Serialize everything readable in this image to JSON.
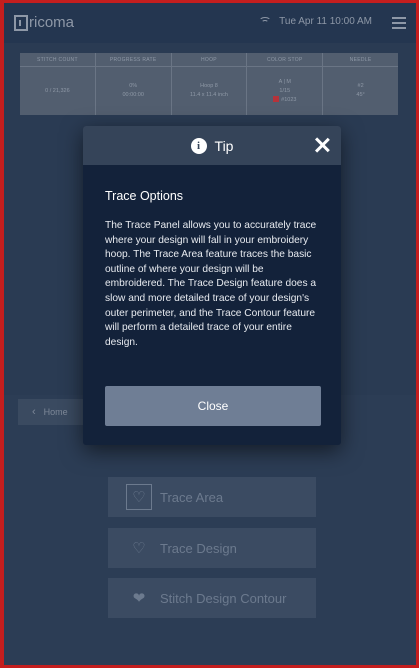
{
  "header": {
    "logo_text": "ricoma",
    "datetime": "Tue Apr 11 10:00 AM"
  },
  "info_strip": {
    "columns": [
      {
        "header": "STITCH COUNT",
        "lines": [
          "0 / 21,326"
        ]
      },
      {
        "header": "PROGRESS RATE",
        "lines": [
          "0%",
          "00:00:00"
        ]
      },
      {
        "header": "HOOP",
        "lines": [
          "Hoop 8",
          "11.4 x 11.4 inch"
        ]
      },
      {
        "header": "COLOR STOP",
        "lines": [
          "A | M",
          "1/15",
          "#1023"
        ]
      },
      {
        "header": "NEEDLE",
        "lines": [
          "#2",
          "45°"
        ]
      }
    ]
  },
  "nav": {
    "home_label": "Home"
  },
  "tools": [
    {
      "label": "Trace Area",
      "icon": "heart-outline-icon"
    },
    {
      "label": "Trace Design",
      "icon": "heart-icon"
    },
    {
      "label": "Stitch Design Contour",
      "icon": "stitched-heart-icon"
    }
  ],
  "modal": {
    "header_title": "Tip",
    "title": "Trace Options",
    "body": "The Trace Panel allows you to accurately trace where your design will fall in your embroidery hoop. The Trace Area feature traces the basic outline of where your design will be embroidered. The Trace Design feature does a slow and more detailed trace of your design's outer perimeter, and the Trace Contour feature will perform a detailed trace of your entire design.",
    "close_label": "Close"
  },
  "colors": {
    "accent_swatch": "#b5333a",
    "modal_bg": "#13223a",
    "close_button": "#6f7e95"
  }
}
